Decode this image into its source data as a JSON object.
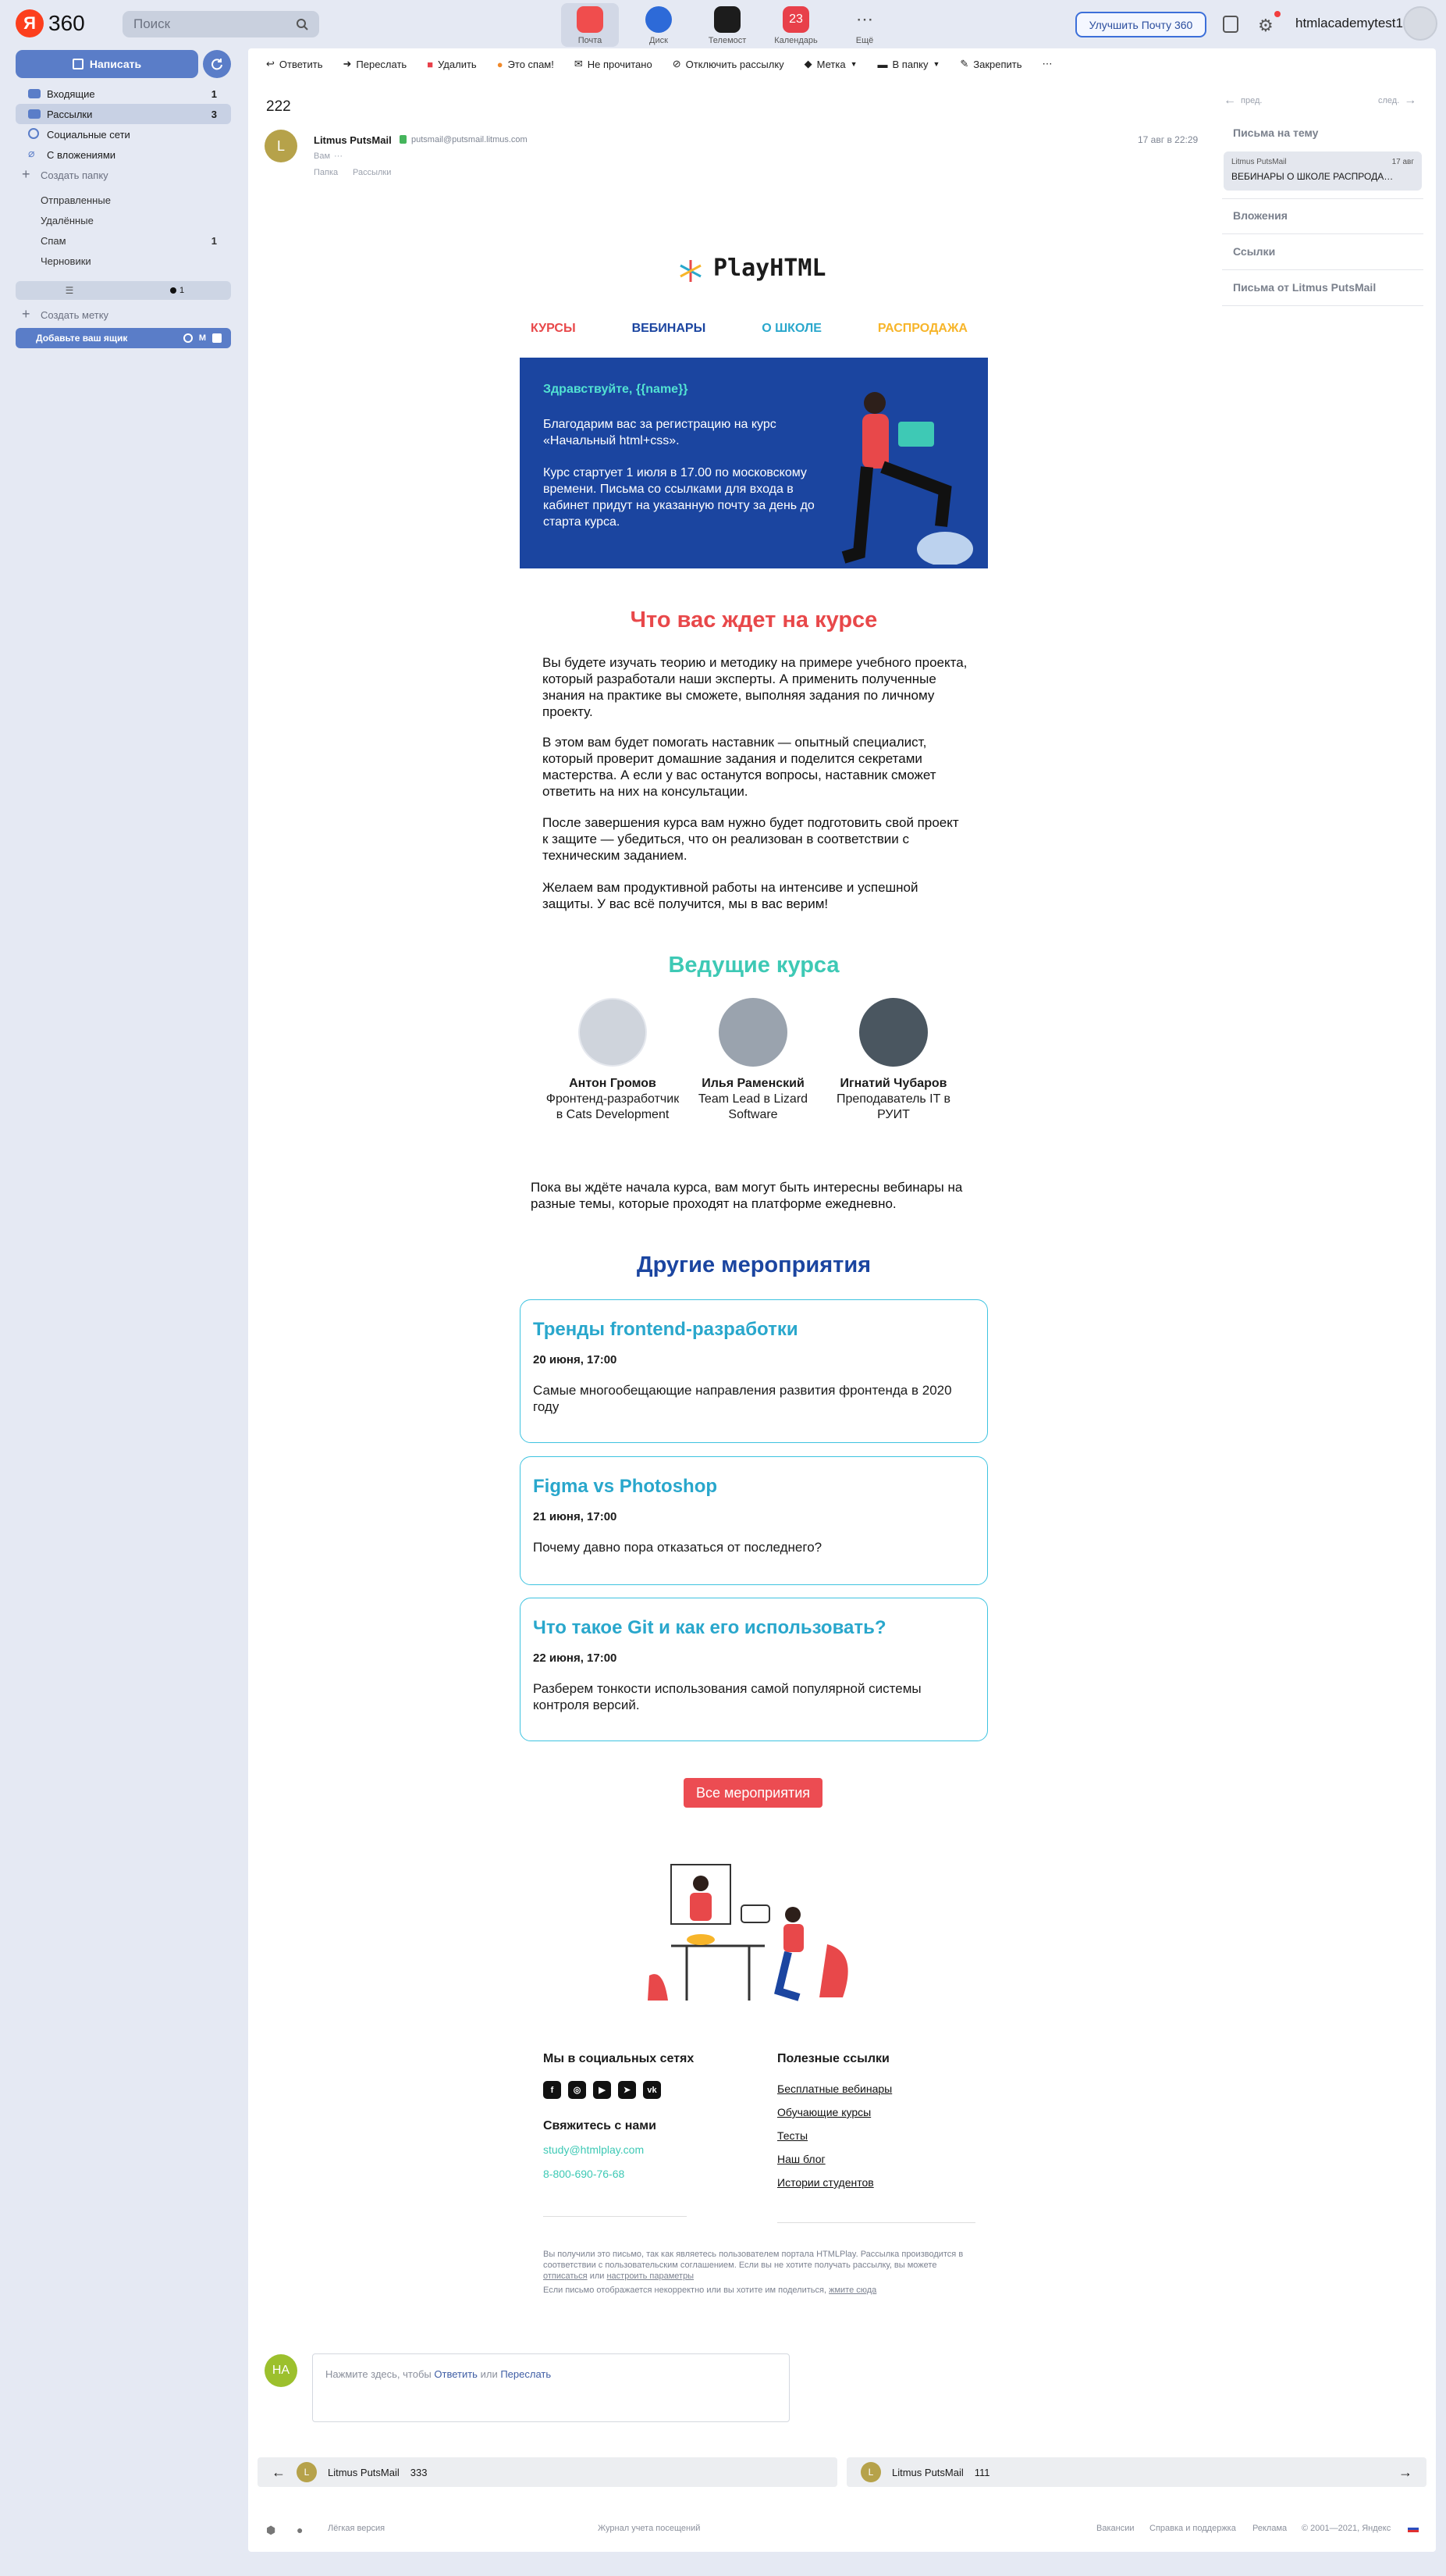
{
  "header": {
    "logo_text": "360",
    "search_placeholder": "Поиск",
    "services": [
      "Почта",
      "Диск",
      "Телемост",
      "Календарь",
      "Ещё"
    ],
    "calendar_day": "23",
    "upgrade": "Улучшить Почту 360",
    "user": "htmlacademytest1"
  },
  "sidebar": {
    "write": "Написать",
    "folders": [
      {
        "label": "Входящие",
        "count": "1"
      },
      {
        "label": "Рассылки",
        "count": "3"
      },
      {
        "label": "Социальные сети",
        "count": ""
      },
      {
        "label": "С вложениями",
        "count": ""
      }
    ],
    "create_folder": "Создать папку",
    "system": [
      {
        "label": "Отправленные",
        "count": ""
      },
      {
        "label": "Удалённые",
        "count": ""
      },
      {
        "label": "Спам",
        "count": "1"
      },
      {
        "label": "Черновики",
        "count": ""
      }
    ],
    "dots_count": "1",
    "create_label": "Создать метку",
    "add_mail": "Добавьте ваш ящик"
  },
  "toolbar": [
    "Ответить",
    "Переслать",
    "Удалить",
    "Это спам!",
    "Не прочитано",
    "Отключить рассылку",
    "Метка",
    "В папку",
    "Закрепить"
  ],
  "message": {
    "subject": "222",
    "sender_initial": "L",
    "sender": "Litmus PutsMail",
    "sender_email": "putsmail@putsmail.litmus.com",
    "to_label": "Вам",
    "to_value": "···",
    "folder_label": "Папка",
    "folder": "Рассылки",
    "date": "17 авг в 22:29"
  },
  "right_pane": {
    "prev": "пред.",
    "next": "след.",
    "thread_title": "Письма на тему",
    "thread_sender": "Litmus PutsMail",
    "thread_time": "17 авг",
    "thread_subject": "ВЕБИНАРЫ О ШКОЛЕ РАСПРОДА…",
    "attachments": "Вложения",
    "links": "Ссылки",
    "from_sender": "Письма от Litmus PutsMail"
  },
  "email": {
    "brand": "PlayHTML",
    "menu": [
      "КУРСЫ",
      "ВЕБИНАРЫ",
      "О ШКОЛЕ",
      "РАСПРОДАЖА"
    ],
    "hero_greeting": "Здравствуйте, {{name}}",
    "hero_p1": "Благодарим вас за регистрацию на курс «Начальный html+css».",
    "hero_p2": "Курс стартует 1 июля в 17.00 по московскому времени. Письма со ссылками для входа в кабинет придут на указанную почту за день до старта курса.",
    "course_title": "Что вас ждет на курсе",
    "course_paragraphs": [
      "Вы будете изучать теорию и методику на примере учебного проекта, который разработали наши эксперты. А применить полученные знания на практике вы сможете, выполняя задания по личному проекту.",
      "В этом вам будет помогать наставник — опытный специалист, который проверит домашние задания и поделится секретами мастерства. А если у вас останутся вопросы, наставник сможет ответить на них на консультации.",
      "После завершения курса вам нужно будет подготовить свой проект к защите — убедиться, что он реализован в соответствии с техническим заданием.",
      "Желаем вам продуктивной работы на интенсиве и успешной защиты. У вас всё получится, мы в вас верим!"
    ],
    "leads_title": "Ведущие курса",
    "leads": [
      {
        "name": "Антон Громов",
        "role": "Фронтенд-разработчик в Cats Development"
      },
      {
        "name": "Илья Раменский",
        "role": "Team Lead в Lizard Software"
      },
      {
        "name": "Игнатий Чубаров",
        "role": "Преподаватель IT в РУИТ"
      }
    ],
    "webinar_note": "Пока вы ждёте начала курса, вам могут быть интересны вебинары на разные темы, которые проходят на платформе ежедневно.",
    "events_title": "Другие мероприятия",
    "events": [
      {
        "title": "Тренды frontend-разработки",
        "date": "20 июня, 17:00",
        "text": "Самые многообещающие направления развития фронтенда в 2020 году"
      },
      {
        "title": "Figma vs Photoshop",
        "date": "21 июня, 17:00",
        "text": "Почему давно пора отказаться от последнего?"
      },
      {
        "title": "Что такое Git и как его использовать?",
        "date": "22 июня, 17:00",
        "text": "Разберем тонкости использования самой популярной системы контроля версий."
      }
    ],
    "all_events": "Все мероприятия",
    "social_title": "Мы в социальных сетях",
    "contact_title": "Свяжитесь с нами",
    "contact_email": "study@htmlplay.com",
    "contact_phone": "8-800-690-76-68",
    "links_title": "Полезные ссылки",
    "links": [
      "Бесплатные вебинары",
      "Обучающие курсы",
      "Тесты",
      "Наш блог",
      "Истории студентов"
    ],
    "legal_1": "Вы получили это письмо, так как являетесь пользователем портала HTMLPlay. Рассылка производится в соответствии с пользовательским соглашением. Если вы не хотите получать рассылку, вы можете",
    "legal_unsub": "отписаться",
    "legal_or": "или",
    "legal_settings": "настроить параметры",
    "legal_2": "Если письмо отображается некорректно или вы хотите им поделиться,",
    "legal_here": "жмите сюда"
  },
  "reply": {
    "initials": "НА",
    "prompt": "Нажмите здесь, чтобы",
    "reply": "Ответить",
    "or": "или",
    "forward": "Переслать"
  },
  "nav": [
    {
      "initial": "L",
      "sender": "Litmus PutsMail",
      "subject": "333"
    },
    {
      "initial": "L",
      "sender": "Litmus PutsMail",
      "subject": "111"
    }
  ],
  "footer": {
    "light": "Лёгкая версия",
    "journal": "Журнал учета посещений",
    "links": [
      "Вакансии",
      "Справка и поддержка",
      "Реклама"
    ],
    "copyright": "© 2001—2021, Яндекс"
  },
  "colors": {
    "accent": "#5a7dc8",
    "hero_bg": "#1b45a0",
    "course_title": "#e8484a",
    "leads_title": "#3ec9b5",
    "events_title": "#1b45a0",
    "event_title": "#29a7cc",
    "button": "#ec4c52"
  }
}
